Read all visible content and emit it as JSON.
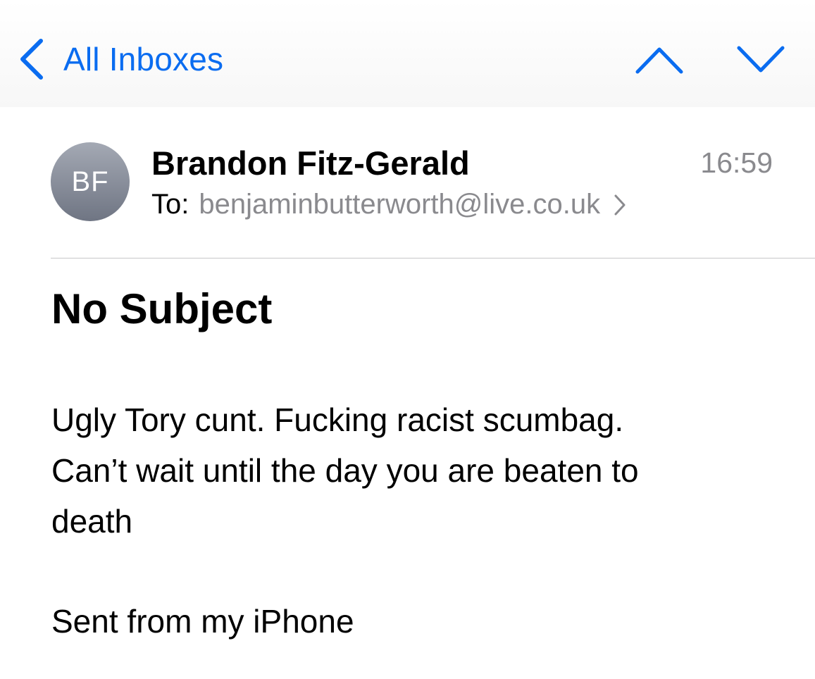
{
  "navbar": {
    "back_label": "All Inboxes",
    "icons": {
      "back": "chevron-left-icon",
      "previous": "chevron-up-icon",
      "next": "chevron-down-icon"
    },
    "accent_color": "#0a6cf0"
  },
  "message": {
    "avatar_initials": "BF",
    "sender": "Brandon Fitz-Gerald",
    "time": "16:59",
    "to_label": "To:",
    "to_address": "benjaminbutterworth@live.co.uk",
    "subject": "No Subject",
    "body_lines": [
      "Ugly Tory cunt. Fucking racist scumbag.",
      "Can’t wait until the day you are beaten to",
      "death"
    ],
    "signature": "Sent from my iPhone"
  }
}
